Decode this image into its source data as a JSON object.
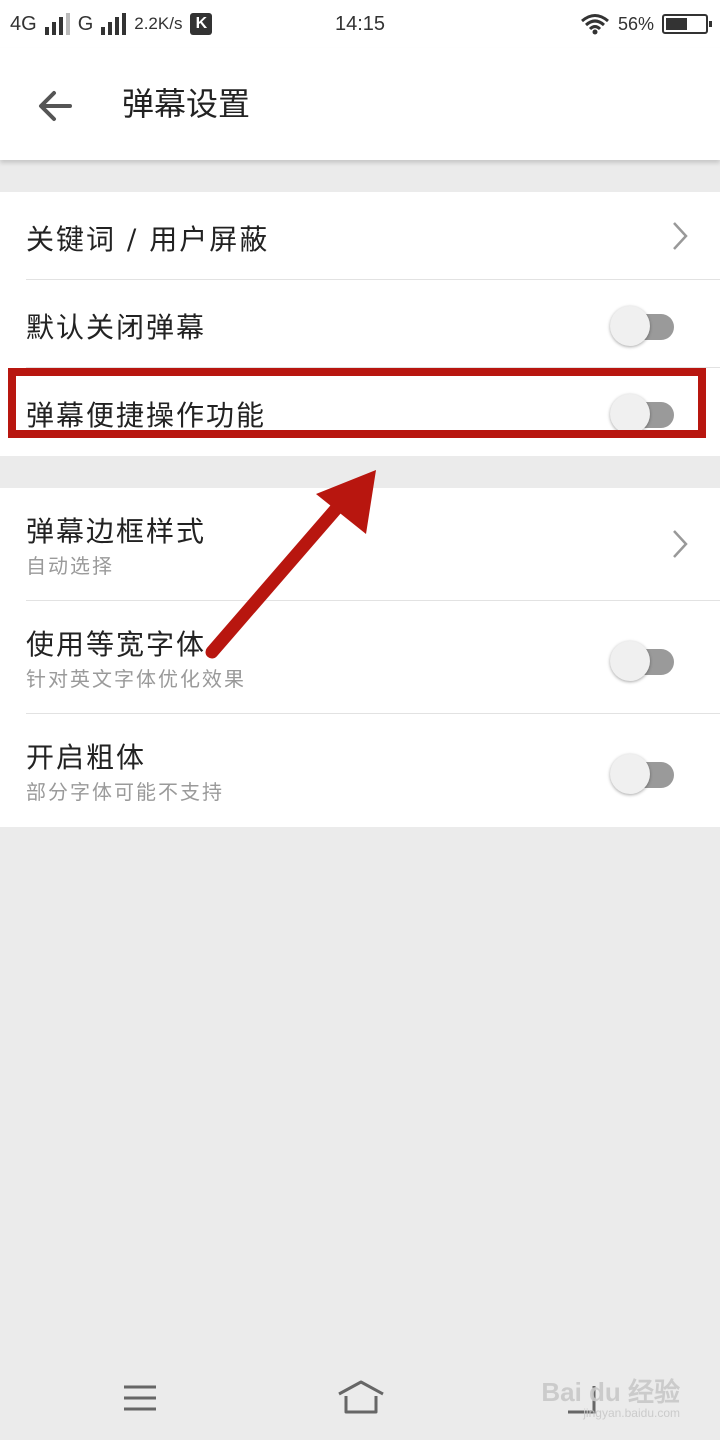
{
  "status_bar": {
    "network1": "4G",
    "network2": "G",
    "speed": "2.2K/s",
    "app_badge": "K",
    "time": "14:15",
    "battery_text": "56%",
    "battery_level": 0.56
  },
  "header": {
    "title": "弹幕设置"
  },
  "group1": [
    {
      "title": "关键词 / 用户屏蔽",
      "control": "chevron"
    },
    {
      "title": "默认关闭弹幕",
      "control": "toggle",
      "on": false
    },
    {
      "title": "弹幕便捷操作功能",
      "control": "toggle",
      "on": false
    }
  ],
  "group2": [
    {
      "title": "弹幕边框样式",
      "subtitle": "自动选择",
      "control": "chevron"
    },
    {
      "title": "使用等宽字体",
      "subtitle": "针对英文字体优化效果",
      "control": "toggle",
      "on": false
    },
    {
      "title": "开启粗体",
      "subtitle": "部分字体可能不支持",
      "control": "toggle",
      "on": false
    }
  ],
  "annotation": {
    "color": "#b8160f"
  },
  "watermark": {
    "text": "Bai du 经验",
    "sub": "jingyan.baidu.com"
  }
}
